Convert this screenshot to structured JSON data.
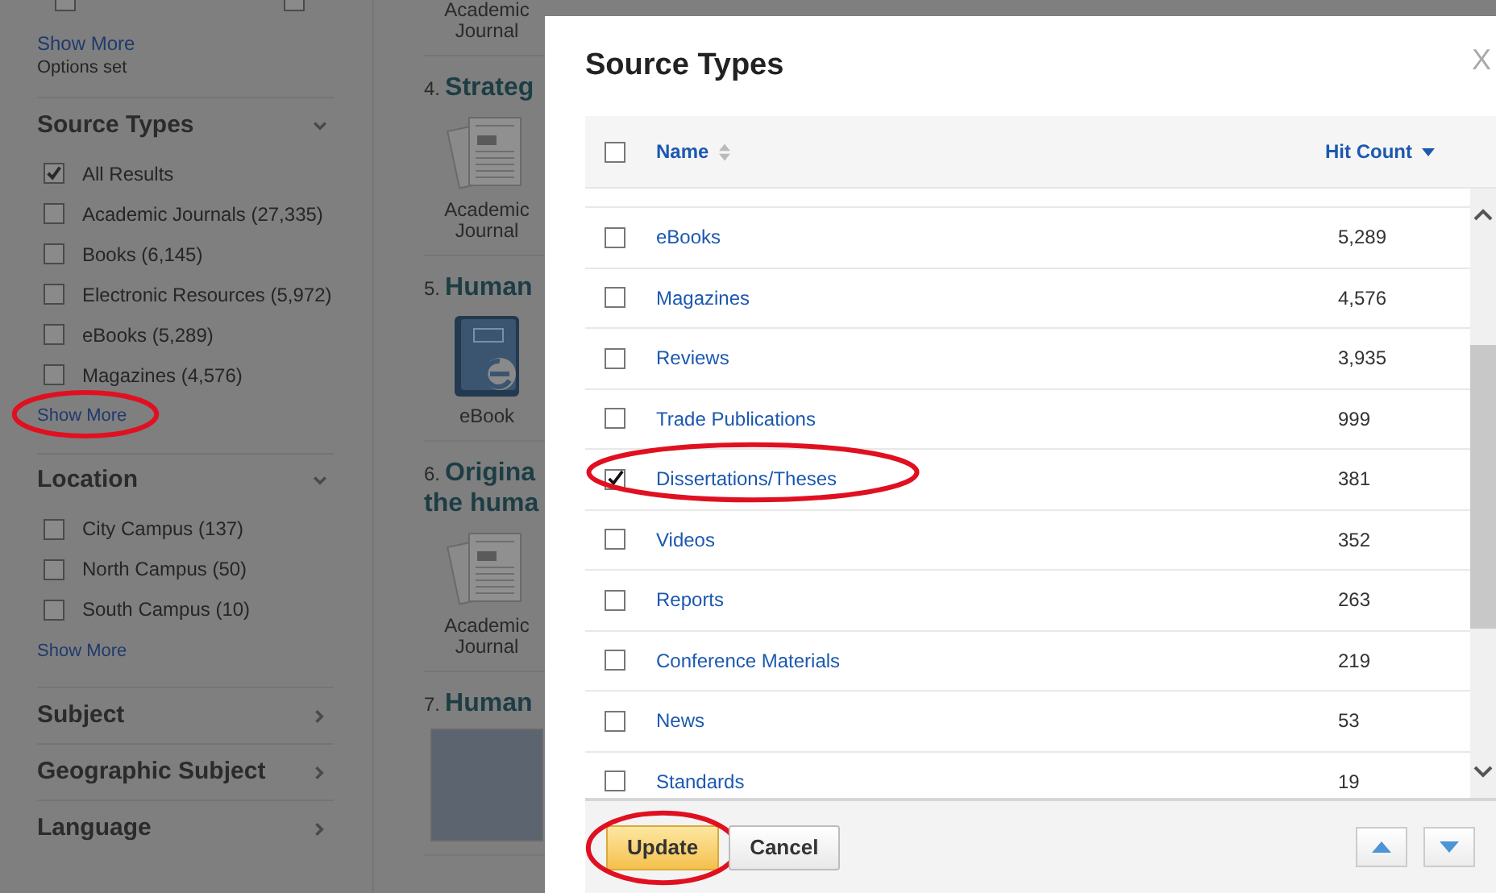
{
  "sidebar": {
    "top_checkboxes": [
      {
        "checked": false
      },
      {
        "checked": false
      }
    ],
    "top_link": {
      "label": "Show More",
      "circled": false
    },
    "top_note": "Options set",
    "sections": [
      {
        "title": "Source Types",
        "expanded": true,
        "items": [
          {
            "label": "All Results",
            "checked": true
          },
          {
            "label": "Academic Journals (27,335)",
            "checked": false
          },
          {
            "label": "Books (6,145)",
            "checked": false
          },
          {
            "label": "Electronic Resources (5,972)",
            "checked": false
          },
          {
            "label": "eBooks (5,289)",
            "checked": false
          },
          {
            "label": "Magazines (4,576)",
            "checked": false
          }
        ],
        "show_more": {
          "label": "Show More",
          "circled": true
        }
      },
      {
        "title": "Location",
        "expanded": true,
        "items": [
          {
            "label": "City Campus (137)",
            "checked": false
          },
          {
            "label": "North Campus (50)",
            "checked": false
          },
          {
            "label": "South Campus (10)",
            "checked": false
          }
        ],
        "show_more": {
          "label": "Show More",
          "circled": false
        }
      },
      {
        "title": "Subject",
        "expanded": false
      },
      {
        "title": "Geographic Subject",
        "expanded": false
      },
      {
        "title": "Language",
        "expanded": false
      }
    ]
  },
  "results": {
    "top_type": "Academic Journal",
    "items": [
      {
        "number": "4.",
        "title": [
          "Strateg"
        ],
        "kind": "journal",
        "type": "Academic Journal"
      },
      {
        "number": "5.",
        "title": [
          "Human"
        ],
        "kind": "ebook",
        "type": "eBook"
      },
      {
        "number": "6.",
        "title": [
          "Origina",
          "the huma"
        ],
        "kind": "journal",
        "type": "Academic Journal"
      },
      {
        "number": "7.",
        "title": [
          "Human"
        ],
        "kind": "cover"
      }
    ]
  },
  "dialog": {
    "title": "Source Types",
    "close": "X",
    "columns": [
      {
        "label": "Name",
        "kind": "sortable"
      },
      {
        "label": "Hit Count",
        "kind": "sorted"
      }
    ],
    "header_checked": false,
    "rows": [
      {
        "name": "eBooks",
        "count": "5,289",
        "checked": false,
        "circled": false
      },
      {
        "name": "Magazines",
        "count": "4,576",
        "checked": false,
        "circled": false
      },
      {
        "name": "Reviews",
        "count": "3,935",
        "checked": false,
        "circled": false
      },
      {
        "name": "Trade Publications",
        "count": "999",
        "checked": false,
        "circled": false
      },
      {
        "name": "Dissertations/Theses",
        "count": "381",
        "checked": true,
        "circled": true
      },
      {
        "name": "Videos",
        "count": "352",
        "checked": false,
        "circled": false
      },
      {
        "name": "Reports",
        "count": "263",
        "checked": false,
        "circled": false
      },
      {
        "name": "Conference Materials",
        "count": "219",
        "checked": false,
        "circled": false
      },
      {
        "name": "News",
        "count": "53",
        "checked": false,
        "circled": false
      },
      {
        "name": "Standards",
        "count": "19",
        "checked": false,
        "circled": false
      }
    ],
    "buttons": [
      {
        "label": "Update",
        "kind": "primary",
        "circled": true
      },
      {
        "label": "Cancel",
        "kind": "secondary",
        "circled": false
      }
    ]
  }
}
